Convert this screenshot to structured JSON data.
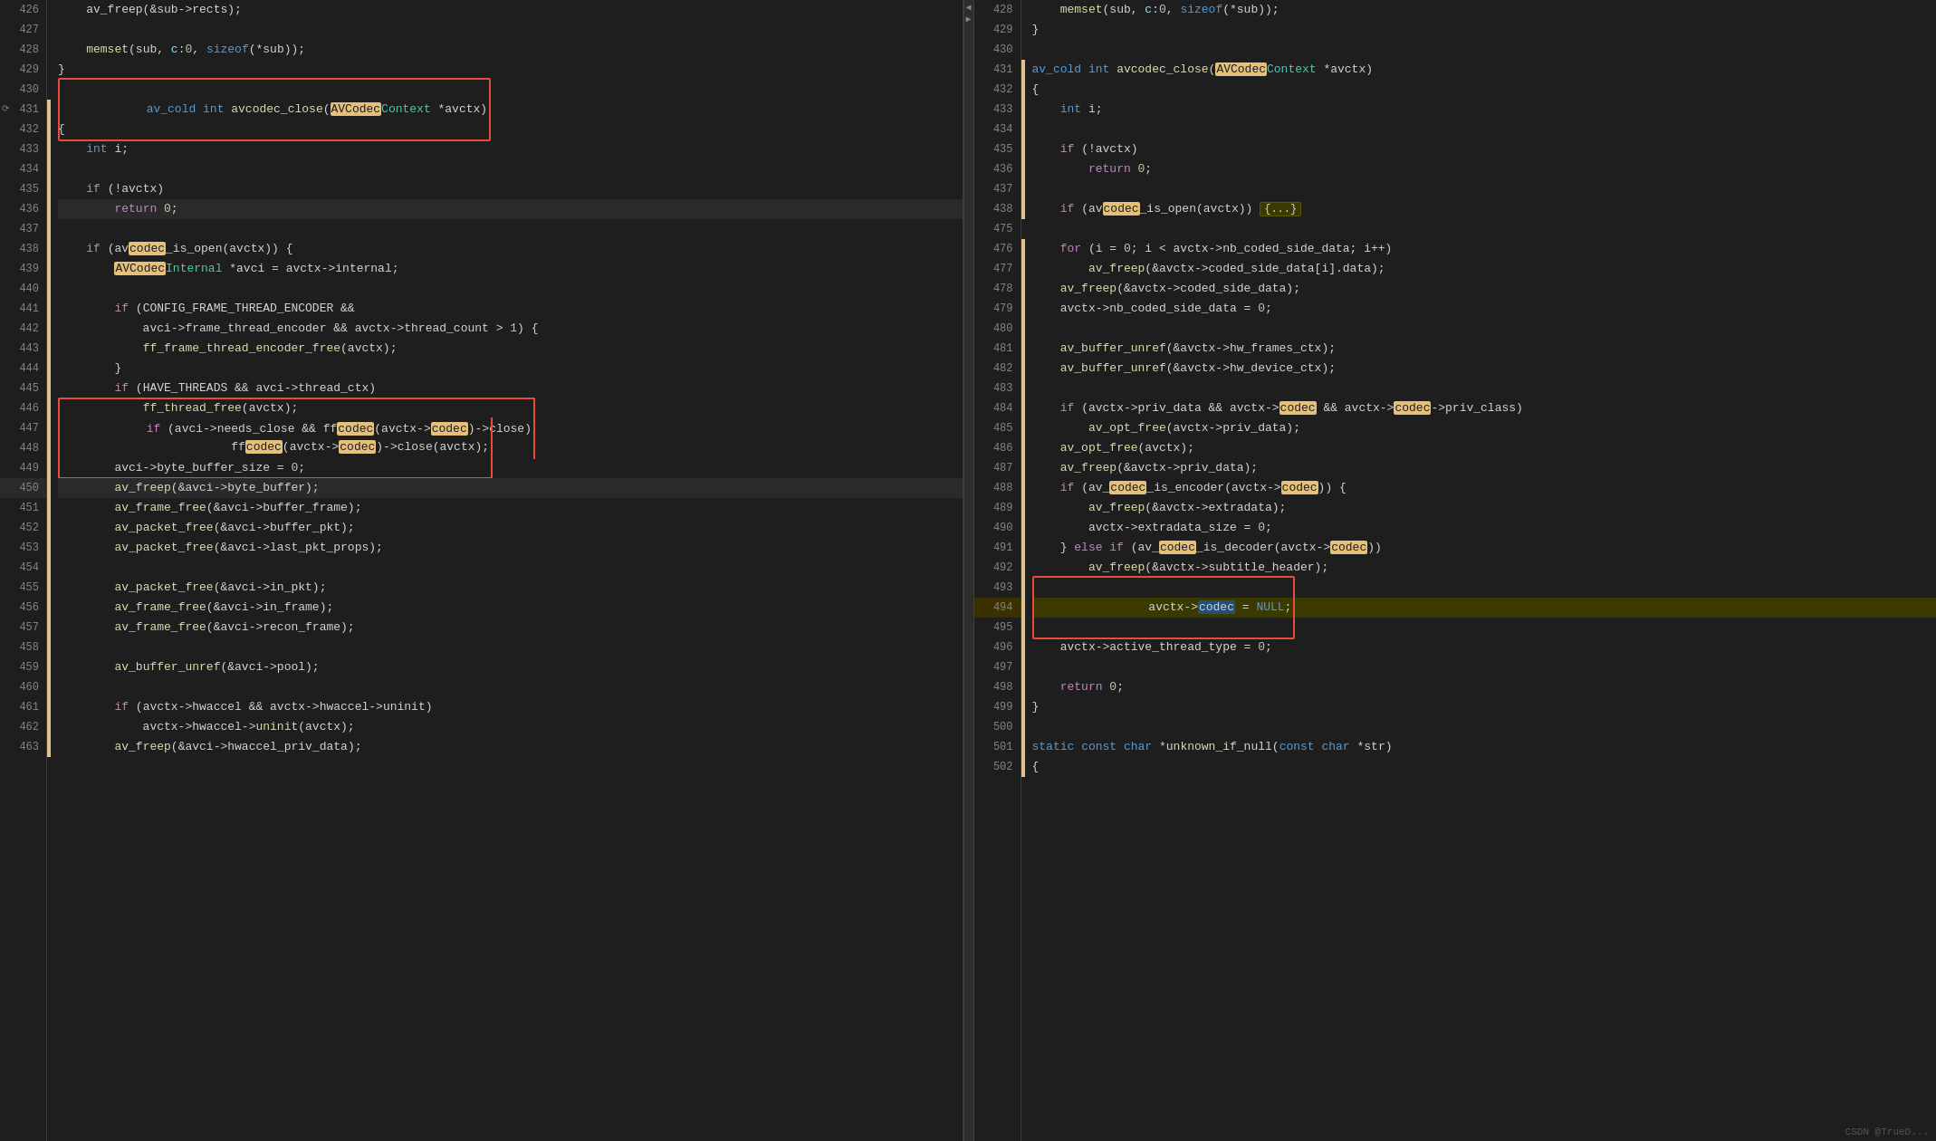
{
  "left_pane": {
    "lines": [
      {
        "num": 426,
        "content": "av_freep(&sub->rects);",
        "indent": 2
      },
      {
        "num": 427,
        "content": "",
        "indent": 0
      },
      {
        "num": 428,
        "content": "memset(sub, c:0, sizeof(*sub));",
        "indent": 2
      },
      {
        "num": 429,
        "content": "}",
        "indent": 1
      },
      {
        "num": 430,
        "content": "",
        "indent": 0
      },
      {
        "num": 431,
        "content": "av_cold int avcodec_close(AVCodecContext *avctx)",
        "indent": 0,
        "boxed": true
      },
      {
        "num": 432,
        "content": "{",
        "indent": 0
      },
      {
        "num": 433,
        "content": "int i;",
        "indent": 2
      },
      {
        "num": 434,
        "content": "",
        "indent": 0
      },
      {
        "num": 435,
        "content": "if (!avctx)",
        "indent": 2
      },
      {
        "num": 436,
        "content": "return 0;",
        "indent": 3,
        "highlighted": true
      },
      {
        "num": 437,
        "content": "",
        "indent": 0
      },
      {
        "num": 438,
        "content": "if (avcodec_is_open(avctx)) {",
        "indent": 2
      },
      {
        "num": 439,
        "content": "AVCodecInternal *avci = avctx->internal;",
        "indent": 3
      },
      {
        "num": 440,
        "content": "",
        "indent": 0
      },
      {
        "num": 441,
        "content": "if (CONFIG_FRAME_THREAD_ENCODER &&",
        "indent": 3
      },
      {
        "num": 442,
        "content": "avci->frame_thread_encoder && avctx->thread_count > 1) {",
        "indent": 4
      },
      {
        "num": 443,
        "content": "ff_frame_thread_encoder_free(avctx);",
        "indent": 4
      },
      {
        "num": 444,
        "content": "}",
        "indent": 3
      },
      {
        "num": 445,
        "content": "if (HAVE_THREADS && avci->thread_ctx)",
        "indent": 3
      },
      {
        "num": 446,
        "content": "ff_thread_free(avctx);",
        "indent": 4
      },
      {
        "num": 447,
        "content": "if (avci->needs_close && ffcodec(avctx->codec)->close)",
        "indent": 3,
        "boxed_start": true
      },
      {
        "num": 448,
        "content": "ffcodec(avctx->codec)->close(avctx);",
        "indent": 4,
        "boxed_end": true
      },
      {
        "num": 449,
        "content": "avci->byte_buffer_size = 0;",
        "indent": 3
      },
      {
        "num": 450,
        "content": "av_freep(&avci->byte_buffer);",
        "indent": 3,
        "highlighted": true
      },
      {
        "num": 451,
        "content": "av_frame_free(&avci->buffer_frame);",
        "indent": 3
      },
      {
        "num": 452,
        "content": "av_packet_free(&avci->buffer_pkt);",
        "indent": 3
      },
      {
        "num": 453,
        "content": "av_packet_free(&avci->last_pkt_props);",
        "indent": 3
      },
      {
        "num": 454,
        "content": "",
        "indent": 0
      },
      {
        "num": 455,
        "content": "av_packet_free(&avci->in_pkt);",
        "indent": 3
      },
      {
        "num": 456,
        "content": "av_frame_free(&avci->in_frame);",
        "indent": 3
      },
      {
        "num": 457,
        "content": "av_frame_free(&avci->recon_frame);",
        "indent": 3
      },
      {
        "num": 458,
        "content": "",
        "indent": 0
      },
      {
        "num": 459,
        "content": "av_buffer_unref(&avci->pool);",
        "indent": 3
      },
      {
        "num": 460,
        "content": "",
        "indent": 0
      },
      {
        "num": 461,
        "content": "if (avctx->hwaccel && avctx->hwaccel->uninit)",
        "indent": 3
      },
      {
        "num": 462,
        "content": "avctx->hwaccel->uninit(avctx);",
        "indent": 4
      },
      {
        "num": 463,
        "content": "av_freep(&avci->hwaccel_priv_data);",
        "indent": 3
      }
    ]
  },
  "right_pane": {
    "lines": [
      {
        "num": 428,
        "content": "memset(sub, c:0, sizeof(*sub));",
        "indent": 2
      },
      {
        "num": 429,
        "content": "}",
        "indent": 1
      },
      {
        "num": 430,
        "content": "",
        "indent": 0
      },
      {
        "num": 431,
        "content": "av_cold int avcodec_close(AVCodecContext *avctx)",
        "indent": 0
      },
      {
        "num": 432,
        "content": "{",
        "indent": 0
      },
      {
        "num": 433,
        "content": "int i;",
        "indent": 2
      },
      {
        "num": 434,
        "content": "",
        "indent": 0
      },
      {
        "num": 435,
        "content": "if (!avctx)",
        "indent": 2
      },
      {
        "num": 436,
        "content": "return 0;",
        "indent": 3
      },
      {
        "num": 437,
        "content": "",
        "indent": 0
      },
      {
        "num": 438,
        "content": "if (avcodec_is_open(avctx)) {...}",
        "indent": 2,
        "collapsed": true
      },
      {
        "num": 475,
        "content": "",
        "indent": 0
      },
      {
        "num": 476,
        "content": "for (i = 0; i < avctx->nb_coded_side_data; i++)",
        "indent": 2
      },
      {
        "num": 477,
        "content": "av_freep(&avctx->coded_side_data[i].data);",
        "indent": 3
      },
      {
        "num": 478,
        "content": "av_freep(&avctx->coded_side_data);",
        "indent": 2
      },
      {
        "num": 479,
        "content": "avctx->nb_coded_side_data = 0;",
        "indent": 2
      },
      {
        "num": 480,
        "content": "",
        "indent": 0
      },
      {
        "num": 481,
        "content": "av_buffer_unref(&avctx->hw_frames_ctx);",
        "indent": 2
      },
      {
        "num": 482,
        "content": "av_buffer_unref(&avctx->hw_device_ctx);",
        "indent": 2
      },
      {
        "num": 483,
        "content": "",
        "indent": 0
      },
      {
        "num": 484,
        "content": "if (avctx->priv_data && avctx->codec && avctx->codec->priv_class)",
        "indent": 2
      },
      {
        "num": 485,
        "content": "av_opt_free(avctx->priv_data);",
        "indent": 3
      },
      {
        "num": 486,
        "content": "av_opt_free(avctx);",
        "indent": 2
      },
      {
        "num": 487,
        "content": "av_freep(&avctx->priv_data);",
        "indent": 2
      },
      {
        "num": 488,
        "content": "if (av_codec_is_encoder(avctx->codec)) {",
        "indent": 2
      },
      {
        "num": 489,
        "content": "av_freep(&avctx->extradata);",
        "indent": 3
      },
      {
        "num": 490,
        "content": "avctx->extradata_size = 0;",
        "indent": 3
      },
      {
        "num": 491,
        "content": "} else if (av_codec_is_decoder(avctx->codec))",
        "indent": 2
      },
      {
        "num": 492,
        "content": "av_freep(&avctx->subtitle_header);",
        "indent": 3
      },
      {
        "num": 493,
        "content": "",
        "indent": 0
      },
      {
        "num": 494,
        "content": "avctx->codec = NULL;",
        "indent": 2,
        "boxed": true
      },
      {
        "num": 495,
        "content": "",
        "indent": 0
      },
      {
        "num": 496,
        "content": "avctx->active_thread_type = 0;",
        "indent": 2
      },
      {
        "num": 497,
        "content": "",
        "indent": 0
      },
      {
        "num": 498,
        "content": "return 0;",
        "indent": 2
      },
      {
        "num": 499,
        "content": "}",
        "indent": 1
      },
      {
        "num": 500,
        "content": "",
        "indent": 0
      },
      {
        "num": 501,
        "content": "static const char *unknown_if_null(const char *str)",
        "indent": 0
      },
      {
        "num": 502,
        "content": "{",
        "indent": 0
      }
    ]
  },
  "watermark": "CSDN @TrueD..."
}
